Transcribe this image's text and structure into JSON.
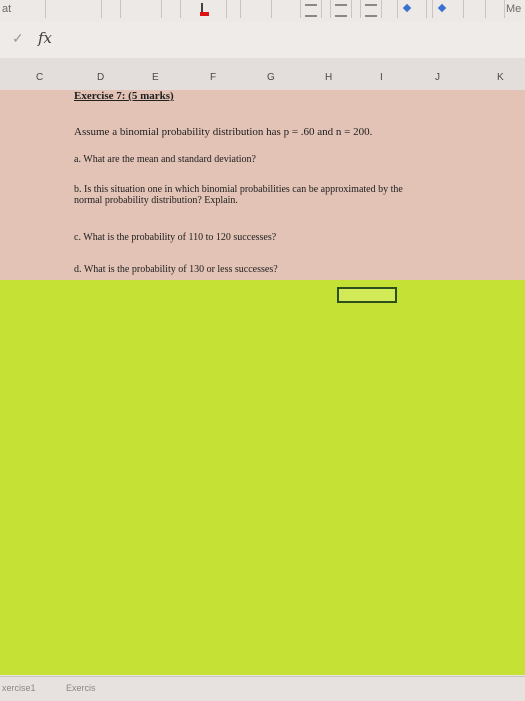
{
  "toolbar": {
    "left_text": "at",
    "right_text": "Me"
  },
  "formula_bar": {
    "fx": "fx"
  },
  "columns": [
    "C",
    "D",
    "E",
    "F",
    "G",
    "H",
    "I",
    "J",
    "K"
  ],
  "exercise": {
    "title": "Exercise 7: (5 marks)",
    "prompt": "Assume a binomial probability distribution has p = .60 and n = 200.",
    "a": "a. What are the mean and standard deviation?",
    "b1": "b. Is this situation one in which binomial probabilities can be approximated by the",
    "b2": "normal probability distribution? Explain.",
    "c": "c. What is the probability of 110 to 120 successes?",
    "d": "d. What is the probability of 130 or less successes?"
  },
  "sheet_tabs": [
    "xercise1",
    "Exercis"
  ]
}
